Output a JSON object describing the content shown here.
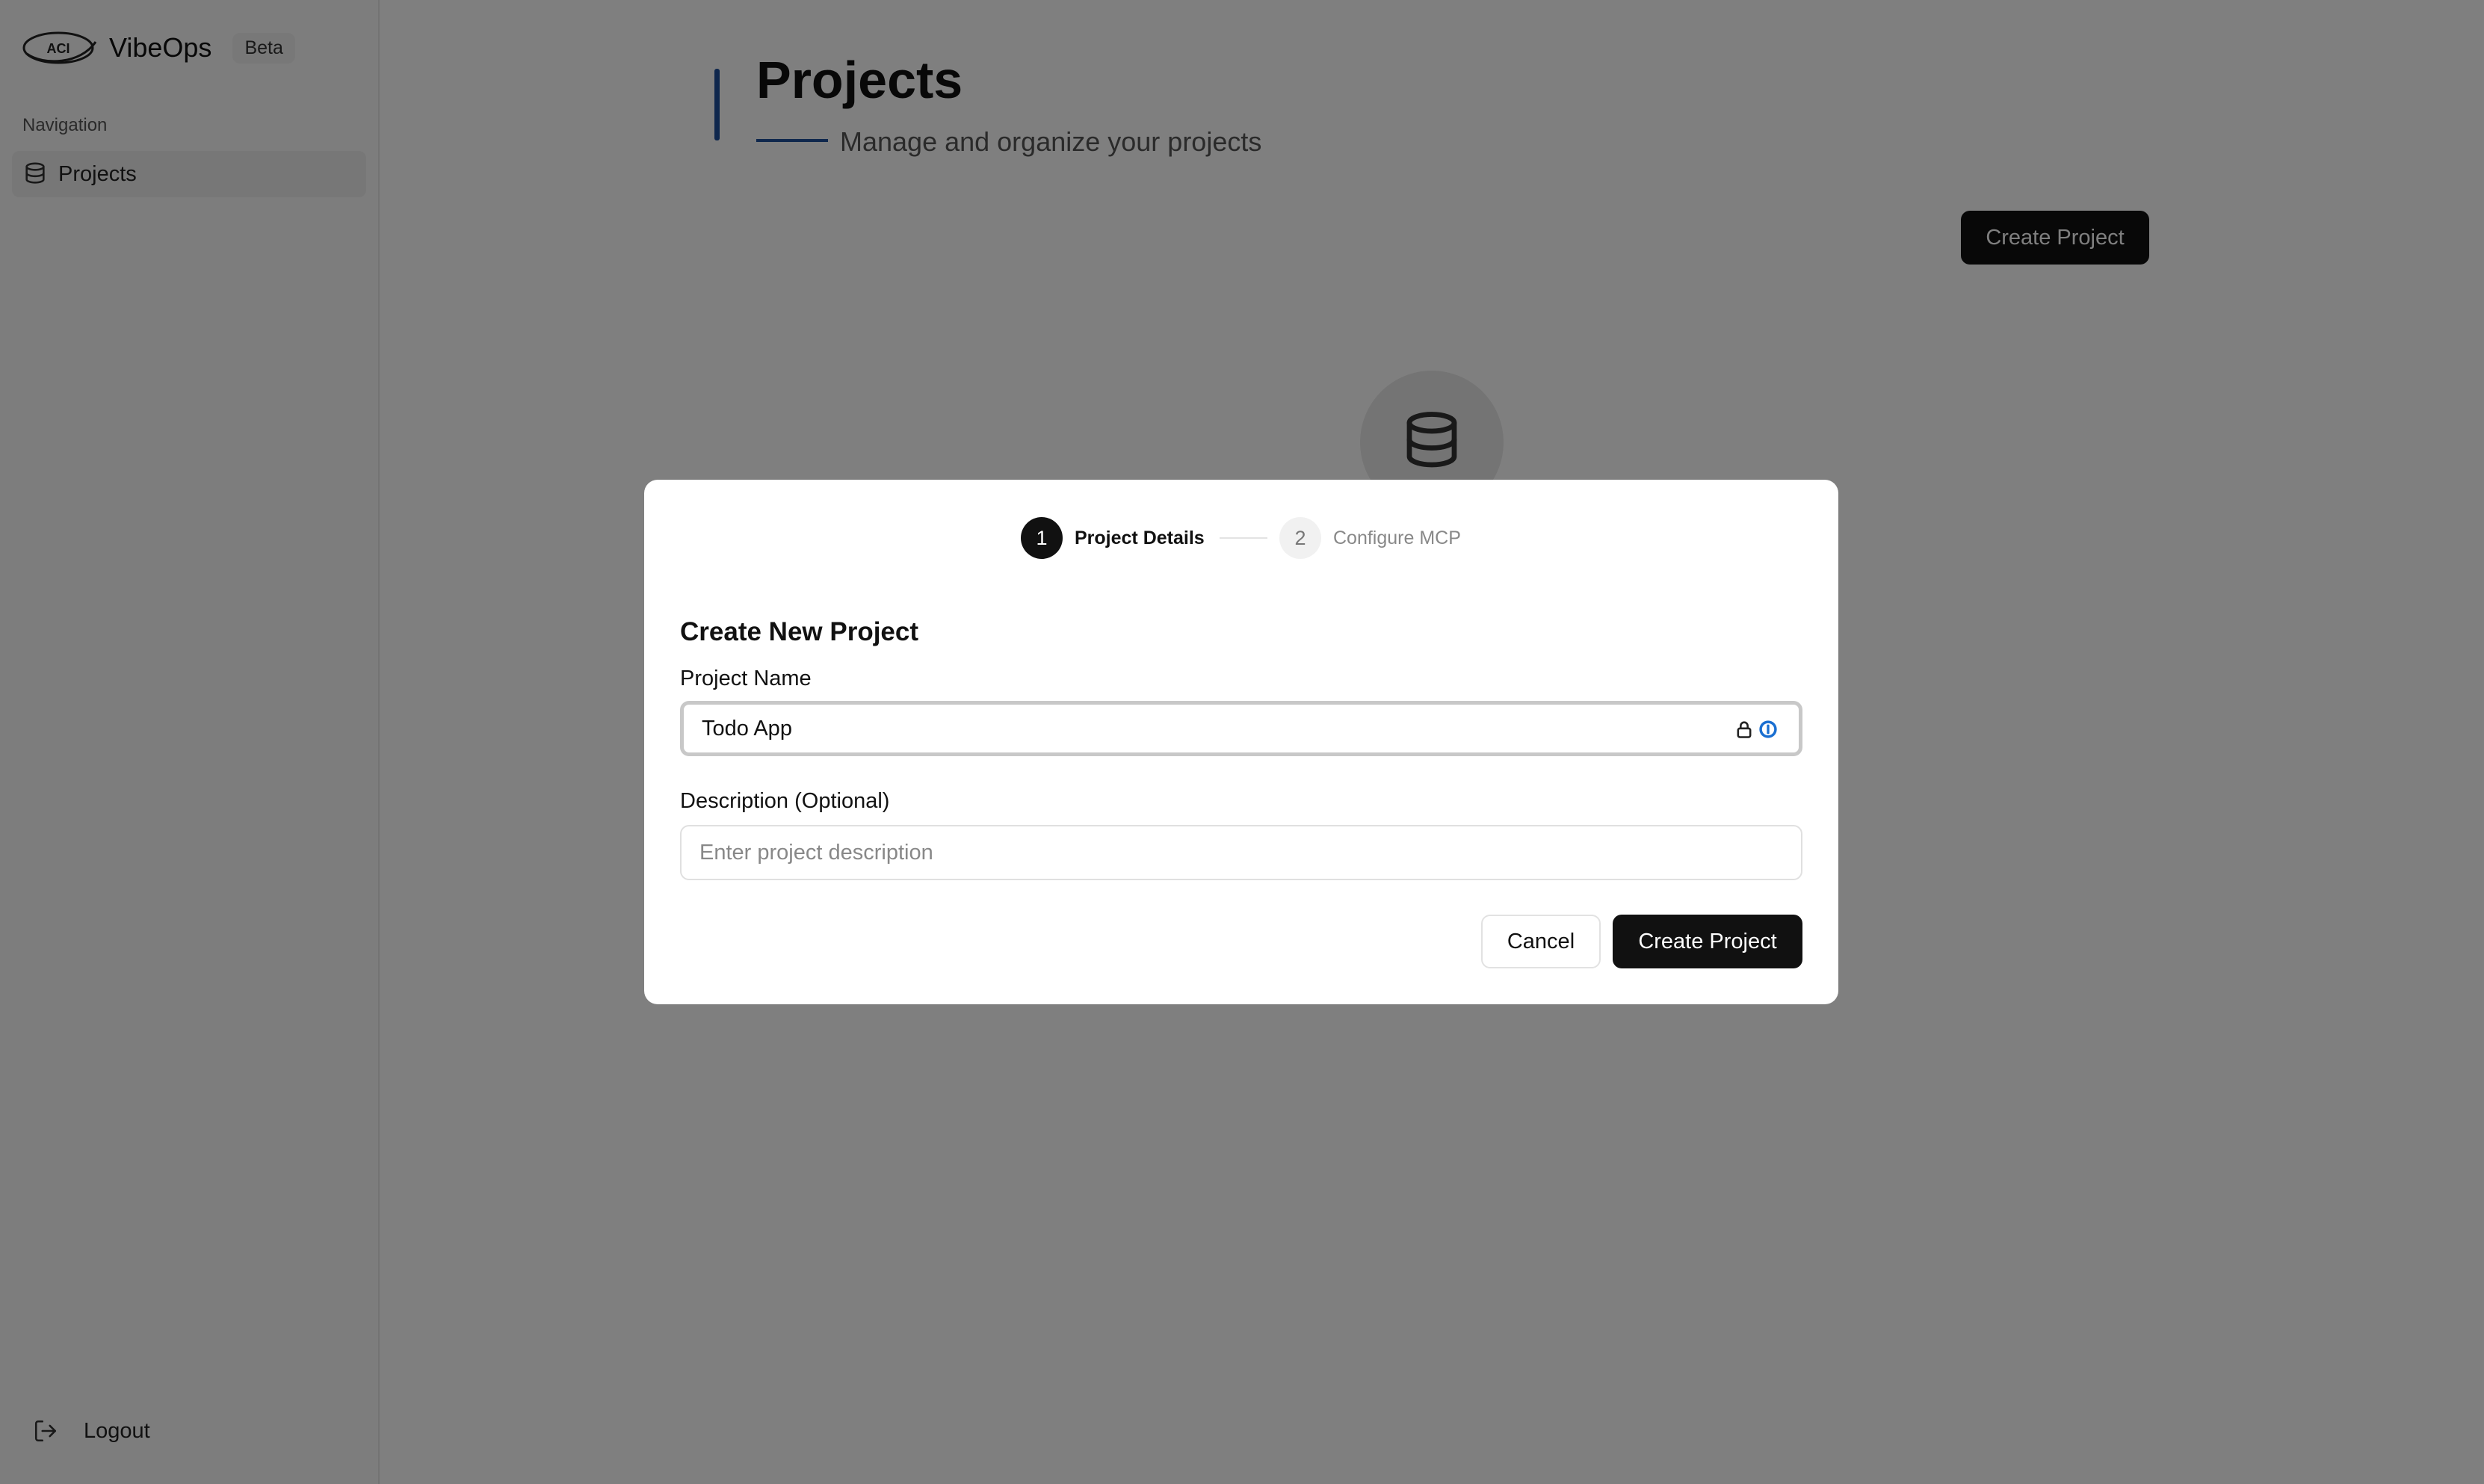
{
  "app": {
    "logo_text": "ACI",
    "name": "VibeOps",
    "badge": "Beta"
  },
  "sidebar": {
    "heading": "Navigation",
    "items": [
      {
        "label": "Projects",
        "icon": "database-icon",
        "active": true
      }
    ],
    "logout_label": "Logout"
  },
  "page": {
    "title": "Projects",
    "subtitle": "Manage and organize your projects",
    "create_button": "Create Project",
    "accent_color": "#1f4f9a",
    "empty_state_icon": "database-icon"
  },
  "modal": {
    "steps": [
      {
        "number": "1",
        "label": "Project Details",
        "active": true
      },
      {
        "number": "2",
        "label": "Configure MCP",
        "active": false
      }
    ],
    "title": "Create New Project",
    "name_label": "Project Name",
    "name_value": "Todo App",
    "description_label": "Description (Optional)",
    "description_placeholder": "Enter project description",
    "description_value": "",
    "cancel_label": "Cancel",
    "submit_label": "Create Project",
    "field_icons": [
      "lock-icon",
      "password-manager-icon"
    ]
  }
}
